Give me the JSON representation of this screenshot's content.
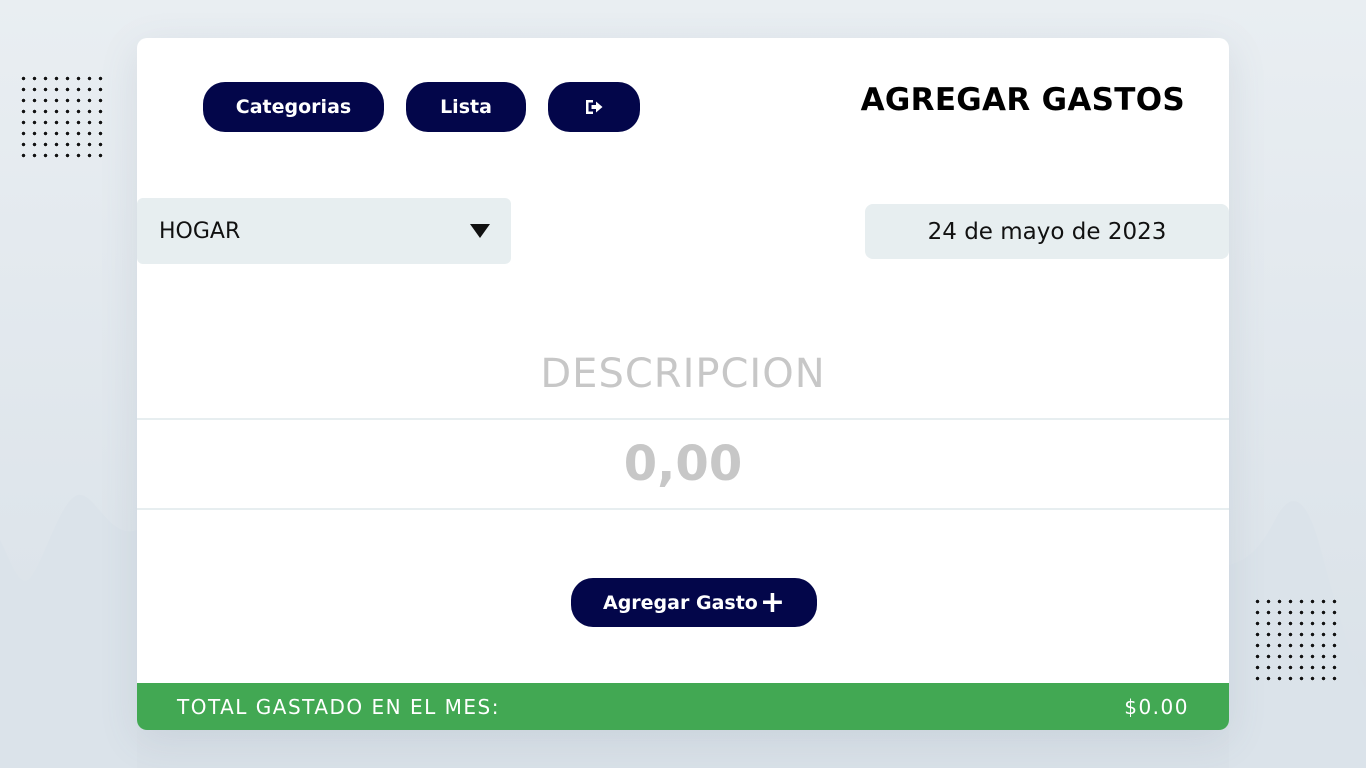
{
  "nav": {
    "categories_label": "Categorias",
    "list_label": "Lista",
    "logout_icon": "logout-icon"
  },
  "title": "AGREGAR GASTOS",
  "form": {
    "category_value": "HOGAR",
    "date_value": "24 de mayo de 2023",
    "description_placeholder": "DESCRIPCION",
    "amount_placeholder": "0,00",
    "submit_label": "Agregar Gasto",
    "submit_icon": "plus-icon",
    "submit_icon_glyph": "+"
  },
  "footer": {
    "total_label": "TOTAL GASTADO EN EL MES:",
    "total_value": "$0.00"
  },
  "colors": {
    "primary": "#03064a",
    "success": "#42a853",
    "field_bg": "#e7eef0",
    "placeholder": "#c7c7c7"
  }
}
